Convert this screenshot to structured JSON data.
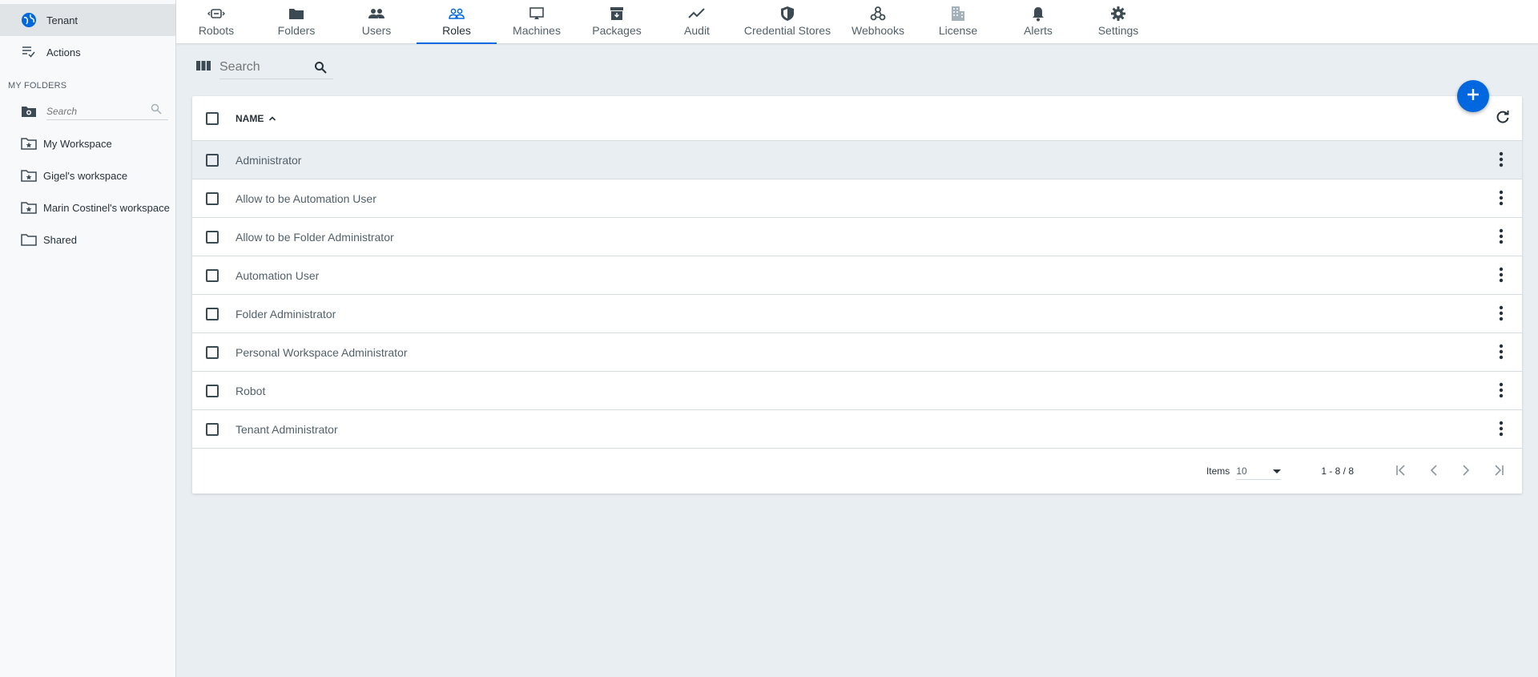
{
  "sidebar": {
    "tenant_label": "Tenant",
    "actions_label": "Actions",
    "my_folders_header": "MY FOLDERS",
    "search_placeholder": "Search",
    "folders": [
      {
        "label": "My Workspace",
        "icon": "folder-star-icon"
      },
      {
        "label": "Gigel's workspace",
        "icon": "folder-star-icon"
      },
      {
        "label": "Marin Costinel's workspace",
        "icon": "folder-star-icon"
      },
      {
        "label": "Shared",
        "icon": "folder-icon"
      }
    ]
  },
  "nav": {
    "tabs": [
      {
        "label": "Robots",
        "icon": "robot-icon"
      },
      {
        "label": "Folders",
        "icon": "folder-icon"
      },
      {
        "label": "Users",
        "icon": "users-icon"
      },
      {
        "label": "Roles",
        "icon": "roles-icon",
        "active": true
      },
      {
        "label": "Machines",
        "icon": "monitor-icon"
      },
      {
        "label": "Packages",
        "icon": "package-icon"
      },
      {
        "label": "Audit",
        "icon": "trend-icon"
      },
      {
        "label": "Credential Stores",
        "icon": "shield-icon"
      },
      {
        "label": "Webhooks",
        "icon": "webhook-icon"
      },
      {
        "label": "License",
        "icon": "building-icon"
      },
      {
        "label": "Alerts",
        "icon": "bell-icon"
      },
      {
        "label": "Settings",
        "icon": "gear-icon"
      }
    ]
  },
  "toolbar": {
    "search_placeholder": "Search"
  },
  "table": {
    "column_name": "NAME",
    "rows": [
      "Administrator",
      "Allow to be Automation User",
      "Allow to be Folder Administrator",
      "Automation User",
      "Folder Administrator",
      "Personal Workspace Administrator",
      "Robot",
      "Tenant Administrator"
    ]
  },
  "pagination": {
    "items_label": "Items",
    "page_size": "10",
    "range": "1 - 8 / 8"
  },
  "colors": {
    "accent": "#0067df",
    "background": "#e9eef2",
    "text": "#273139"
  }
}
